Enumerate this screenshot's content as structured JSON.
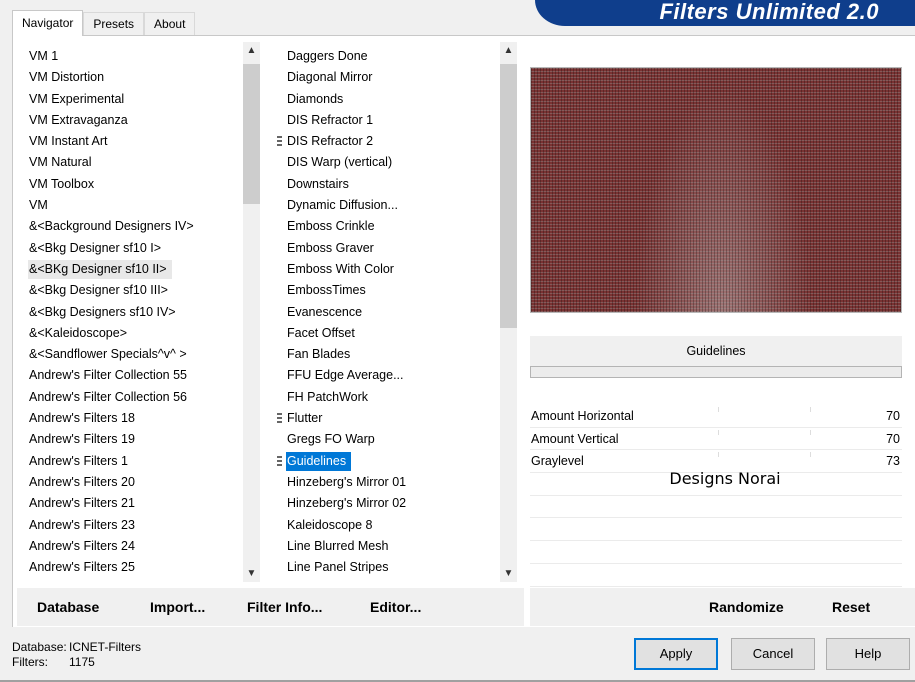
{
  "tabs": [
    "Navigator",
    "Presets",
    "About"
  ],
  "banner_title": "Filters Unlimited 2.0",
  "categories": [
    "VM 1",
    "VM Distortion",
    "VM Experimental",
    "VM Extravaganza",
    "VM Instant Art",
    "VM Natural",
    "VM Toolbox",
    "VM",
    "&<Background Designers IV>",
    "&<Bkg Designer sf10 I>",
    "&<BKg Designer sf10 II>",
    "&<Bkg Designer sf10 III>",
    "&<Bkg Designers sf10 IV>",
    "&<Kaleidoscope>",
    "&<Sandflower Specials^v^ >",
    "Andrew's Filter Collection 55",
    "Andrew's Filter Collection 56",
    "Andrew's Filters 18",
    "Andrew's Filters 19",
    "Andrew's Filters 1",
    "Andrew's Filters 20",
    "Andrew's Filters 21",
    "Andrew's Filters 23",
    "Andrew's Filters 24",
    "Andrew's Filters 25"
  ],
  "selected_category": "&<BKg Designer sf10 II>",
  "filters": [
    "Daggers Done",
    "Diagonal Mirror",
    "Diamonds",
    "DIS Refractor 1",
    "DIS Refractor 2",
    "DIS Warp (vertical)",
    "Downstairs",
    "Dynamic Diffusion...",
    "Emboss Crinkle",
    "Emboss Graver",
    "Emboss With Color",
    "EmbossTimes",
    "Evanescence",
    "Facet Offset",
    "Fan Blades",
    "FFU Edge Average...",
    "FH PatchWork",
    "Flutter",
    "Gregs FO Warp",
    "Guidelines",
    "Hinzeberg's Mirror 01",
    "Hinzeberg's Mirror 02",
    "Kaleidoscope 8",
    "Line Blurred Mesh",
    "Line Panel Stripes"
  ],
  "marked_filters": [
    "DIS Refractor 2",
    "Flutter",
    "Guidelines"
  ],
  "selected_filter": "Guidelines",
  "filter_title": "Guidelines",
  "params": [
    {
      "label": "Amount Horizontal",
      "value": "70"
    },
    {
      "label": "Amount Vertical",
      "value": "70"
    },
    {
      "label": "Graylevel",
      "value": "73"
    }
  ],
  "watermark": "Designs Norai",
  "left_buttons": {
    "database": "Database",
    "import": "Import...",
    "filter_info": "Filter Info...",
    "editor": "Editor..."
  },
  "right_buttons": {
    "randomize": "Randomize",
    "reset": "Reset"
  },
  "footer": {
    "database_label": "Database:",
    "database_value": "ICNET-Filters",
    "filters_label": "Filters:",
    "filters_value": "1175"
  },
  "dialog_buttons": {
    "apply": "Apply",
    "cancel": "Cancel",
    "help": "Help"
  },
  "colors": {
    "banner": "#0f3e8c",
    "selection": "#0078d7",
    "preview_base": "#7a3333"
  }
}
